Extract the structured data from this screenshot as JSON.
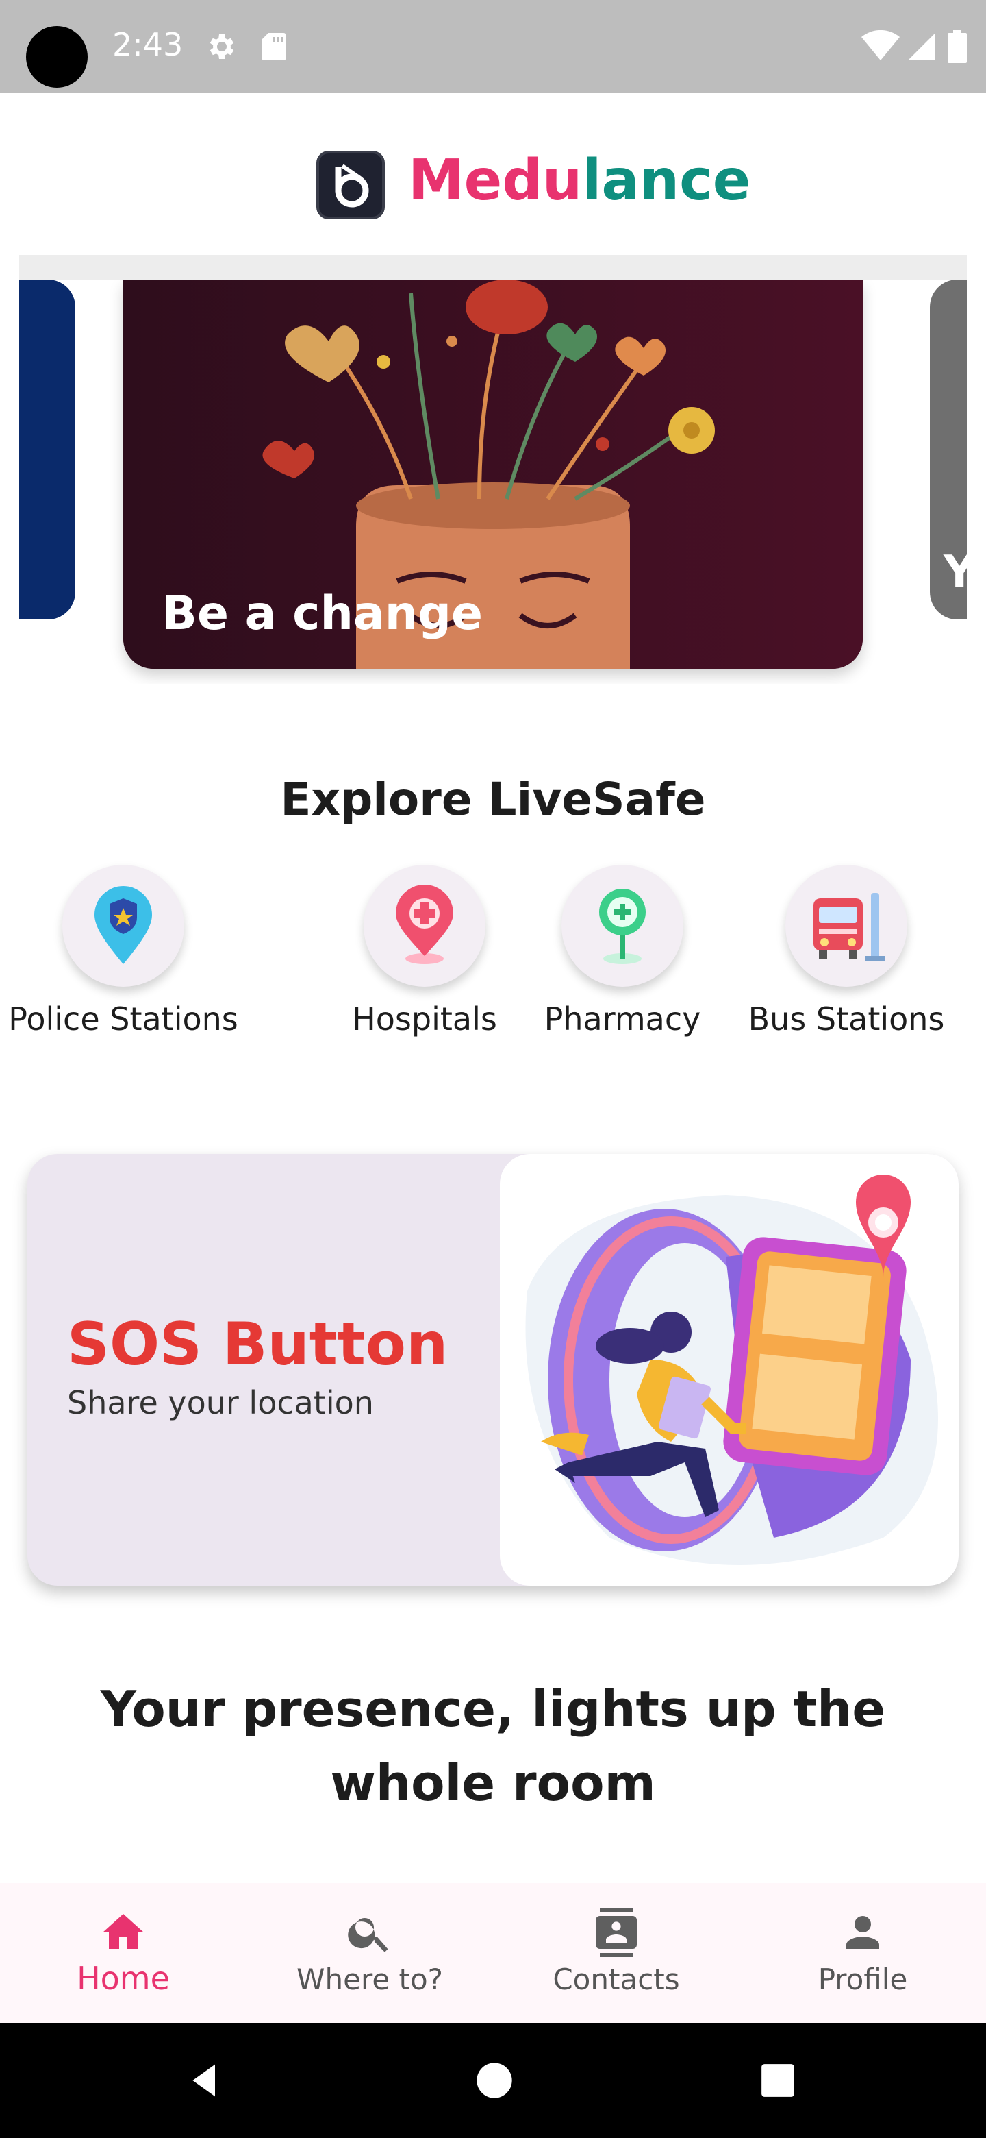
{
  "status_bar": {
    "time": "2:43",
    "icons": [
      "settings-icon",
      "sd-card-icon",
      "wifi-icon",
      "signal-icon",
      "battery-icon"
    ]
  },
  "header": {
    "brand_part1": "Medu",
    "brand_part2": "lance",
    "brand_colors": {
      "pink": "#e8336f",
      "teal": "#0f8f7f"
    }
  },
  "carousel": {
    "main_caption": "Be a change",
    "right_peek_letter": "Y"
  },
  "explore": {
    "title": "Explore LiveSafe",
    "items": [
      {
        "label": "Police Stations",
        "icon": "police-pin-icon"
      },
      {
        "label": "Hospitals",
        "icon": "hospital-pin-icon"
      },
      {
        "label": "Pharmacy",
        "icon": "pharmacy-pin-icon"
      },
      {
        "label": "Bus Stations",
        "icon": "bus-icon"
      }
    ]
  },
  "sos": {
    "title": "SOS Button",
    "subtitle": "Share your location"
  },
  "tagline": "Your presence, lights up the whole room",
  "bottom_nav": {
    "items": [
      {
        "label": "Home",
        "icon": "home-icon",
        "active": true
      },
      {
        "label": "Where to?",
        "icon": "search-icon",
        "active": false
      },
      {
        "label": "Contacts",
        "icon": "contacts-icon",
        "active": false
      },
      {
        "label": "Profile",
        "icon": "person-icon",
        "active": false
      }
    ],
    "accent": "#e8336f"
  },
  "system_nav": [
    "back-icon",
    "home-circle-icon",
    "recents-icon"
  ]
}
